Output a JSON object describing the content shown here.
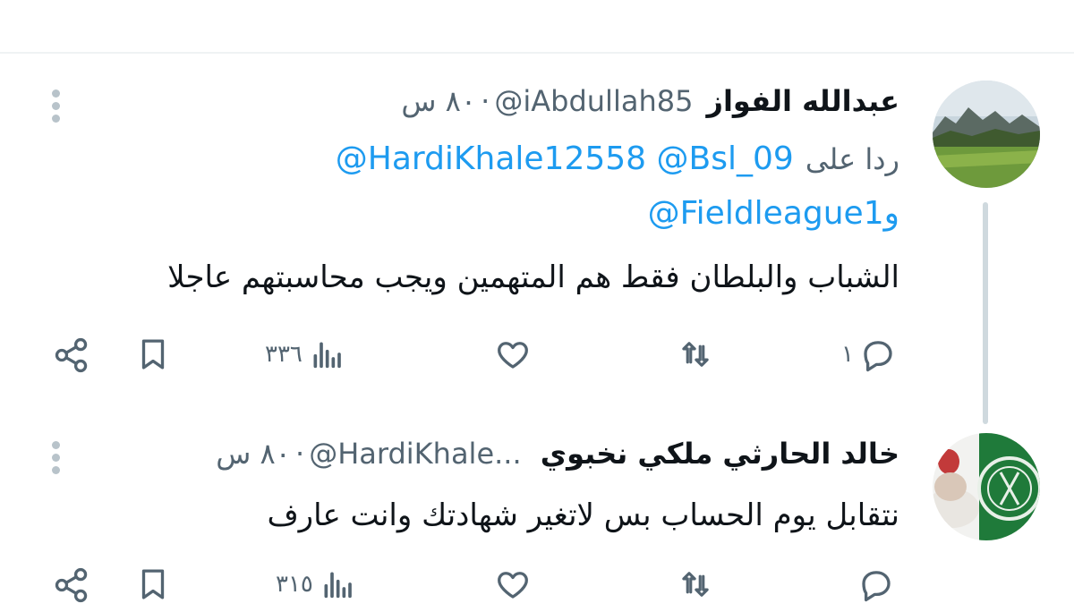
{
  "tweets": [
    {
      "name": "عبدالله الفواز",
      "handle": "@iAbdullah85",
      "time": "٨٠ س",
      "reply_prefix": "ردا على",
      "mentions_line1": "@HardiKhale12558 @Bsl_09",
      "mentions_line2_prefix": "و",
      "mentions_line2": "@Fieldleague1",
      "text": "الشباب والبلطان فقط هم المتهمين ويجب محاسبتهم عاجلا",
      "replies": "١",
      "views": "٣٣٦"
    },
    {
      "name": "خالد الحارثي ملكي نخبوي",
      "handle": "@HardiKhale...",
      "time": "٨٠ س",
      "text": "نتقابل يوم الحساب بس لاتغير شهادتك وانت عارف",
      "views": "٣١٥"
    }
  ],
  "colors": {
    "link": "#1d9bf0",
    "muted": "#536471",
    "divider": "#eff3f4",
    "thread": "#cfd9de"
  }
}
